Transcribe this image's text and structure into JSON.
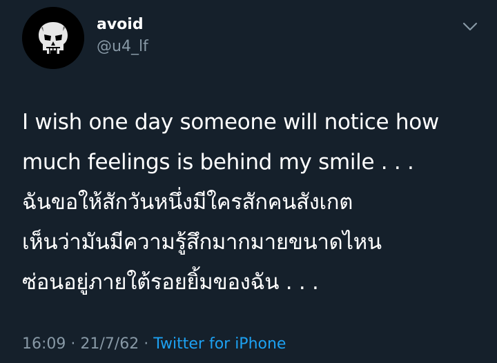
{
  "tweet": {
    "author": {
      "display_name": "avoid",
      "handle": "@u4_lf",
      "avatar_icon": "punisher-skull-icon"
    },
    "menu_icon": "chevron-down-icon",
    "text_lines": [
      "I wish one day someone will notice how",
      "much feelings is behind my smile . . .",
      "ฉันขอให้สักวันหนึ่งมีใครสักคนสังเกต",
      "เห็นว่ามันมีความรู้สึกมากมายขนาดไหน",
      "ซ่อนอยู่ภายใต้รอยยิ้มของฉัน . . ."
    ],
    "meta": {
      "time": "16:09",
      "separator": "·",
      "date": "21/7/62",
      "source": "Twitter for iPhone"
    }
  },
  "colors": {
    "background": "#15202b",
    "text": "#ffffff",
    "secondary_text": "#8899a6",
    "link": "#1da1f2"
  }
}
